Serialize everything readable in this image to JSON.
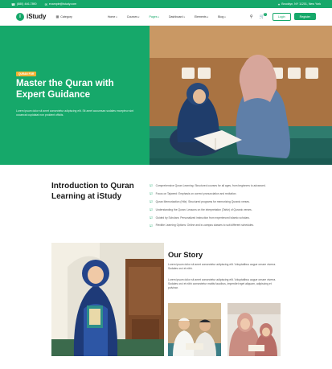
{
  "topbar": {
    "phone": "(880) 446-7890",
    "email": "example@istudy.com",
    "address": "Brooklyn, NY 11201, New York"
  },
  "header": {
    "logo_mark": "i",
    "logo_text": "iStudy",
    "category_label": "Category",
    "nav": [
      {
        "label": "Home"
      },
      {
        "label": "Courses"
      },
      {
        "label": "Pages"
      },
      {
        "label": "Dashboard"
      },
      {
        "label": "Elements"
      },
      {
        "label": "Blog"
      }
    ],
    "active_nav": "Pages",
    "cart_count": "0",
    "login_label": "Login",
    "register_label": "Register"
  },
  "hero": {
    "badge": "QURAN FOR",
    "title": "Master the Quran with Expert Guidance",
    "description": "Lorem ipsum dolor sit amet consectetur adipiscing elit. Sit amet accumsan sodales excepteur sint occaecat cupidatat non proident officiis."
  },
  "intro": {
    "title": "Introduction to Quran Learning at iStudy",
    "items": [
      "Comprehensive Quran Learning: Structured courses for all ages, from beginners to advanced.",
      "Focus on Tajweed: Emphasis on correct pronunciation and recitation.",
      "Quran Memorization (Hifz): Structured programs for memorizing Quranic verses.",
      "Understanding the Quran: Lessons on the interpretation (Tafsir) of Quranic verses.",
      "Guided by Scholars: Personalized instruction from experienced Islamic scholars.",
      "Flexible Learning Options: Online and in-campus classes to suit different schedules."
    ]
  },
  "story": {
    "title": "Our Story",
    "paragraph1": "Lorem ipsum dolor sit amet consectetur adipiscing elit. Voluptatibus augue ornare viverra. Sodales orci et nibh.",
    "paragraph2": "Lorem ipsum dolor sit amet consectetur adipiscing elit. Voluptatibus augue ornare viverra. Sodales orci et nibh consectetur mattis faucibus, imperdiet eget aliquam, adipiscing et pulvinar."
  },
  "colors": {
    "brand_green": "#16a86a",
    "badge_yellow": "#f2b233"
  },
  "icons": [
    "phone-icon",
    "mail-icon",
    "location-icon",
    "grid-icon",
    "search-icon",
    "cart-icon",
    "check-icon"
  ]
}
